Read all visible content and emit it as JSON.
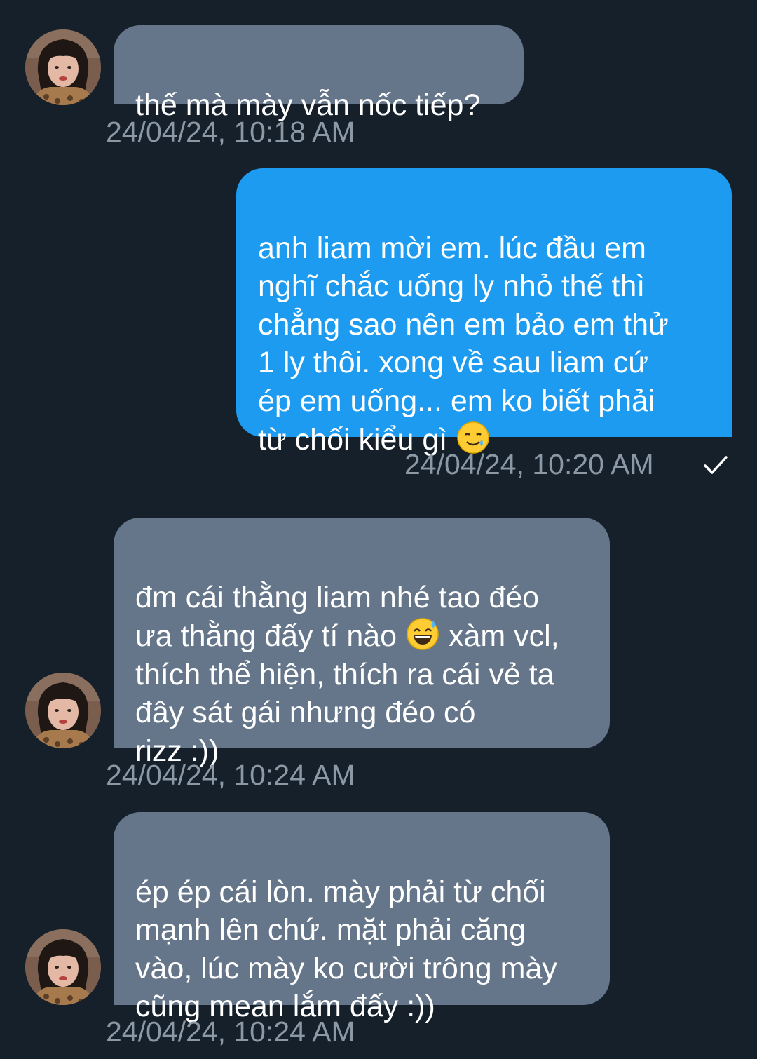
{
  "messages": [
    {
      "direction": "incoming",
      "text": "thế mà mày vẫn nốc tiếp?",
      "timestamp": "24/04/24, 10:18 AM"
    },
    {
      "direction": "outgoing",
      "text_before_emoji": "anh liam mời em. lúc đầu em\nnghĩ chắc uống ly nhỏ thế thì\nchẳng sao nên em bảo em thử\n1 ly thôi. xong về sau liam cứ\nép em uống... em ko biết phải\ntừ chối kiểu gì ",
      "emoji": "smiling-face-with-tear",
      "timestamp": "24/04/24, 10:20 AM",
      "status": "sent-check"
    },
    {
      "direction": "incoming",
      "text_before_emoji": "đm cái thằng liam nhé tao đéo\nưa thằng đấy tí nào ",
      "emoji": "grinning-face-with-sweat",
      "text_after_emoji": " xàm vcl,\nthích thể hiện, thích ra cái vẻ ta\nđây sát gái nhưng đéo có\nrizz :))",
      "timestamp": "24/04/24, 10:24 AM"
    },
    {
      "direction": "incoming",
      "text": "ép ép cái lòn. mày phải từ chối\nmạnh lên chứ. mặt phải căng\nvào, lúc mày ko cười trông mày\ncũng mean lắm đấy :))",
      "timestamp": "24/04/24, 10:24 AM"
    }
  ],
  "colors": {
    "background": "#15202b",
    "incoming_bubble": "#66768a",
    "outgoing_bubble": "#1d9bf0",
    "timestamp": "#8b98a5"
  }
}
